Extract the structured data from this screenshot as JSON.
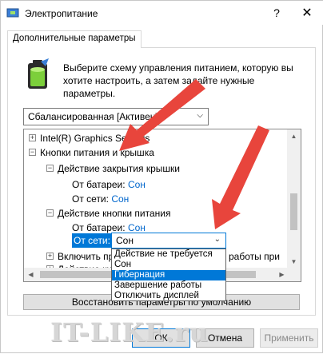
{
  "window": {
    "title": "Электропитание",
    "help_glyph": "?",
    "close_glyph": "✕"
  },
  "tab": {
    "label": "Дополнительные параметры"
  },
  "description": "Выберите схему управления питанием, которую вы хотите настроить, а затем задайте нужные параметры.",
  "scheme_select": {
    "value": "Сбалансированная [Активен]"
  },
  "tree": {
    "items": [
      {
        "label": "Intel(R) Graphics Settings",
        "expander": "+"
      },
      {
        "label": "Кнопки питания и крышка",
        "expander": "−"
      },
      {
        "label": "Действие закрытия крышки",
        "expander": "−"
      },
      {
        "label": "От батареи:",
        "value": "Сон"
      },
      {
        "label": "От сети:",
        "value": "Сон"
      },
      {
        "label": "Действие кнопки питания",
        "expander": "−"
      },
      {
        "label": "От батареи:",
        "value": "Сон"
      },
      {
        "label": "От сети:"
      },
      {
        "label": "Включить прр...",
        "suffix": "работы при",
        "expander": "+"
      },
      {
        "label": "Действие кно...",
        "expander": "+"
      }
    ]
  },
  "combo": {
    "value": "Сон",
    "options": [
      {
        "label": "Действие не требуется",
        "selected": false
      },
      {
        "label": "Сон",
        "selected": false
      },
      {
        "label": "Гибернация",
        "selected": true
      },
      {
        "label": "Завершение работы",
        "selected": false
      },
      {
        "label": "Отключить дисплей",
        "selected": false
      }
    ]
  },
  "restore_button": {
    "label": "Восстановить параметры по умолчанию"
  },
  "buttons": {
    "ok": "ОК",
    "cancel": "Отмена",
    "apply": "Применить"
  },
  "watermark": "IT-LIKE.ru",
  "colors": {
    "accent": "#0078d7",
    "arrow": "#e8453c",
    "link": "#0066cc"
  }
}
